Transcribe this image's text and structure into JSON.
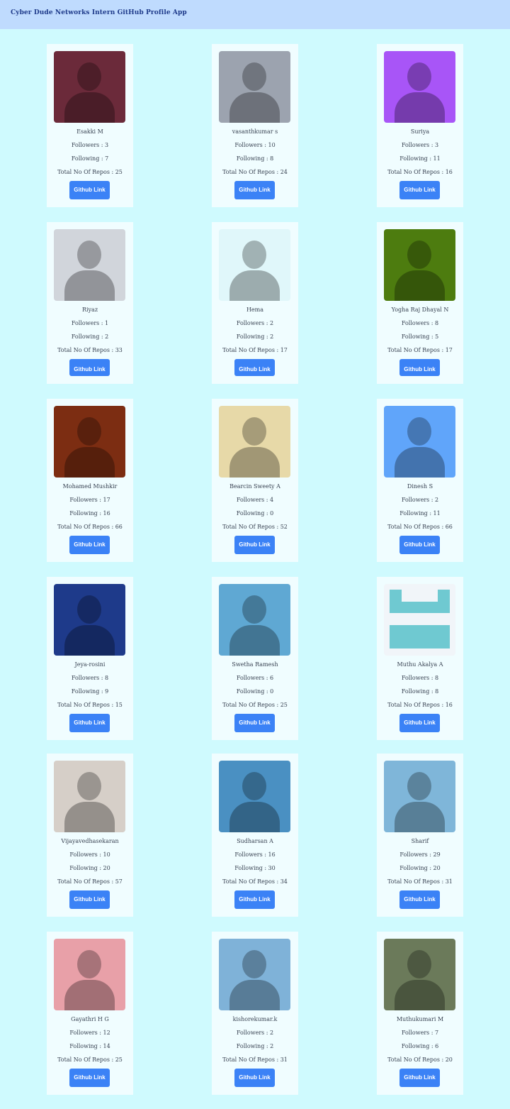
{
  "app": {
    "title": "Cyber Dude Networks Intern GitHub Profile App"
  },
  "button_label": "Github Link",
  "profiles": [
    {
      "name": "Esakki M",
      "followers": "Followers : 3",
      "following": "Following : 7",
      "repos": "Total No Of Repos : 25",
      "avatar_color": "#6b2a3a"
    },
    {
      "name": "vasanthkumar s",
      "followers": "Followers : 10",
      "following": "Following : 8",
      "repos": "Total No Of Repos : 24",
      "avatar_color": "#9ca3af"
    },
    {
      "name": "Suriya",
      "followers": "Followers : 3",
      "following": "Following : 11",
      "repos": "Total No Of Repos : 16",
      "avatar_color": "#a855f7"
    },
    {
      "name": "Riyaz",
      "followers": "Followers : 1",
      "following": "Following : 2",
      "repos": "Total No Of Repos : 33",
      "avatar_color": "#d1d5db"
    },
    {
      "name": "Hema",
      "followers": "Followers : 2",
      "following": "Following : 2",
      "repos": "Total No Of Repos : 17",
      "avatar_color": "#e0f7fa"
    },
    {
      "name": "Yogha Raj Dhayal N",
      "followers": "Followers : 8",
      "following": "Following : 5",
      "repos": "Total No Of Repos : 17",
      "avatar_color": "#4d7c0f"
    },
    {
      "name": "Mohamed Mushkir",
      "followers": "Followers : 17",
      "following": "Following : 16",
      "repos": "Total No Of Repos : 66",
      "avatar_color": "#7c2d12"
    },
    {
      "name": "Bearcin Sweety A",
      "followers": "Followers : 4",
      "following": "Following : 0",
      "repos": "Total No Of Repos : 52",
      "avatar_color": "#e7d9a8"
    },
    {
      "name": "Dinesh S",
      "followers": "Followers : 2",
      "following": "Following : 11",
      "repos": "Total No Of Repos : 66",
      "avatar_color": "#60a5fa"
    },
    {
      "name": "Jeya-rosini",
      "followers": "Followers : 8",
      "following": "Following : 9",
      "repos": "Total No Of Repos : 15",
      "avatar_color": "#1e3a8a"
    },
    {
      "name": "Swetha Ramesh",
      "followers": "Followers : 6",
      "following": "Following : 0",
      "repos": "Total No Of Repos : 25",
      "avatar_color": "#5fa8d3"
    },
    {
      "name": "Muthu Akalya A",
      "followers": "Followers : 8",
      "following": "Following : 8",
      "repos": "Total No Of Repos : 16",
      "avatar_color": "#6fc9d1"
    },
    {
      "name": "Vijayavedhasekaran",
      "followers": "Followers : 10",
      "following": "Following : 20",
      "repos": "Total No Of Repos : 57",
      "avatar_color": "#d6cfc8"
    },
    {
      "name": "Sudharsan A",
      "followers": "Followers : 16",
      "following": "Following : 30",
      "repos": "Total No Of Repos : 34",
      "avatar_color": "#4a90c2"
    },
    {
      "name": "Sharif",
      "followers": "Followers : 29",
      "following": "Following : 20",
      "repos": "Total No Of Repos : 31",
      "avatar_color": "#7fb6d9"
    },
    {
      "name": "Gayathri H G",
      "followers": "Followers : 12",
      "following": "Following : 14",
      "repos": "Total No Of Repos : 25",
      "avatar_color": "#e8a0a8"
    },
    {
      "name": "kishorekumar.k",
      "followers": "Followers : 2",
      "following": "Following : 2",
      "repos": "Total No Of Repos : 31",
      "avatar_color": "#7fb2d8"
    },
    {
      "name": "Muthukumari M",
      "followers": "Followers : 7",
      "following": "Following : 6",
      "repos": "Total No Of Repos : 20",
      "avatar_color": "#6b7a5a"
    }
  ]
}
